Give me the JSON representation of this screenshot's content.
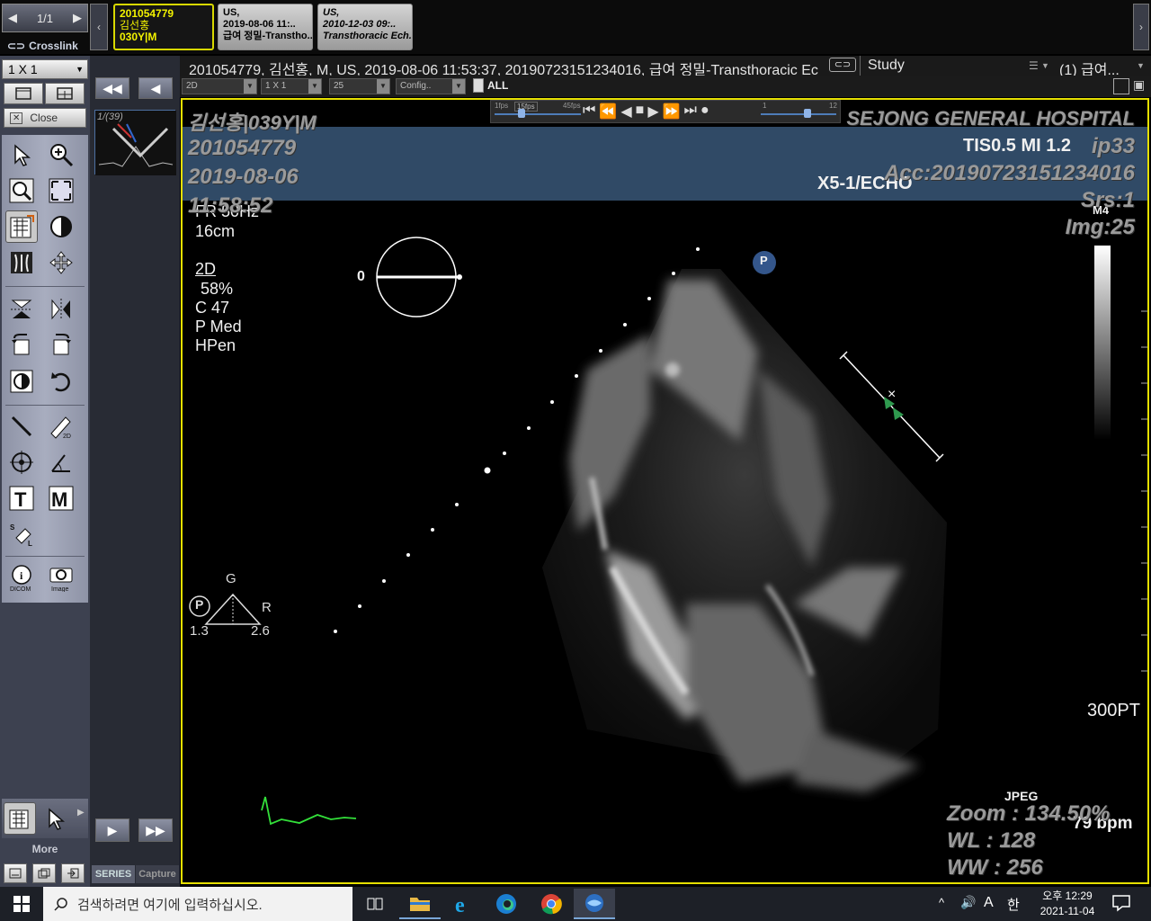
{
  "nav": {
    "page": "1/1",
    "crosslink_label": "Crosslink",
    "layout_value": "1 X 1",
    "close_label": "Close"
  },
  "tabs": [
    {
      "id": "201054779",
      "name": "김선홍",
      "age_sex": "030Y|M"
    },
    {
      "modality": "US,",
      "datetime": "2019-08-06 11:..",
      "desc": "급여 정밀-Transtho.."
    },
    {
      "modality": "US,",
      "datetime": "2010-12-03 09:..",
      "desc": "Transthoracic Ech.."
    }
  ],
  "thumb": {
    "label": "1/(39)"
  },
  "info_bar": {
    "text": "201054779, 김선홍, M, US, 2019-08-06 11:53:37, 20190723151234016, 급여 정밀-Transthoracic Ec",
    "study_label": "Study",
    "right_label": "(1) 급여..."
  },
  "toolbar": {
    "mode": "2D",
    "layout": "1 X 1",
    "frame": "25",
    "config": "Config..",
    "all_label": "ALL"
  },
  "player": {
    "fps_min": "1fps",
    "fps_val": "15fps",
    "fps_max": "45fps",
    "slider_min": "1",
    "slider_max": "12"
  },
  "overlay": {
    "patient": "김선홍|039Y|M",
    "patient_id": "201054779",
    "study_date": "2019-08-06",
    "study_time": "11:58:52",
    "hospital": "SEJONG GENERAL HOSPITAL",
    "ip": "ip33",
    "acc": "Acc:20190723151234016",
    "series": "Srs:1",
    "image": "Img:25",
    "zoom": "Zoom : 134.50%",
    "wl": "WL : 128",
    "ww": "WW : 256"
  },
  "echo": {
    "tis": "TIS0.5   MI 1.2",
    "probe": "X5-1/ECHO",
    "fr": "FR 50Hz",
    "depth": "16cm",
    "mode": "2D",
    "gain": "58%",
    "c": "C 47",
    "p": "P Med",
    "hpen": "HPen",
    "angle": "0",
    "m4": "M4",
    "g": "G",
    "r": "R",
    "tri_left": "1.3",
    "tri_right": "2.6",
    "bottom_right": "300PT",
    "jpeg": "JPEG",
    "bpm": "79 bpm",
    "p_marker": "P"
  },
  "left_bottom": {
    "more_label": "More",
    "series_tab": "SERIES",
    "capture_tab": "Capture"
  },
  "taskbar": {
    "search_placeholder": "검색하려면 여기에 입력하십시오.",
    "time": "오후 12:29",
    "date": "2021-11-04",
    "ime": "한",
    "ime_a": "A"
  }
}
